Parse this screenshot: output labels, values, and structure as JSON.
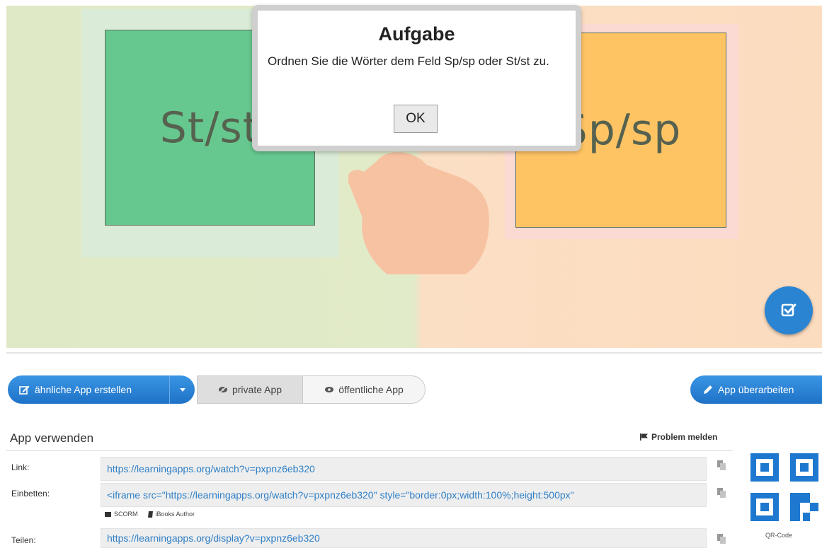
{
  "game": {
    "left_box_label": "St/st",
    "right_box_label": "Sp/sp",
    "colors": {
      "left_box": "#67c88f",
      "right_box": "#fec464",
      "check_button": "#2a84d2"
    }
  },
  "dialog": {
    "title": "Aufgabe",
    "message": "Ordnen Sie die Wörter dem Feld Sp/sp oder St/st zu.",
    "ok_label": "OK"
  },
  "toolbar": {
    "create_label": "ähnliche App erstellen",
    "private_label": "private App",
    "public_label": "öffentliche App",
    "edit_label": "App überarbeiten"
  },
  "use_app": {
    "title": "App verwenden",
    "report_label": "Problem melden",
    "rows": [
      {
        "label": "Link:",
        "value": "https://learningapps.org/watch?v=pxpnz6eb320"
      },
      {
        "label": "Einbetten:",
        "value": "<iframe src=\"https://learningapps.org/watch?v=pxpnz6eb320\" style=\"border:0px;width:100%;height:500px\""
      },
      {
        "label": "Teilen:",
        "value": "https://learningapps.org/display?v=pxpnz6eb320"
      }
    ],
    "export": {
      "scorm": "SCORM",
      "ibooks": "iBooks Author"
    },
    "qr_label": "QR-Code"
  }
}
